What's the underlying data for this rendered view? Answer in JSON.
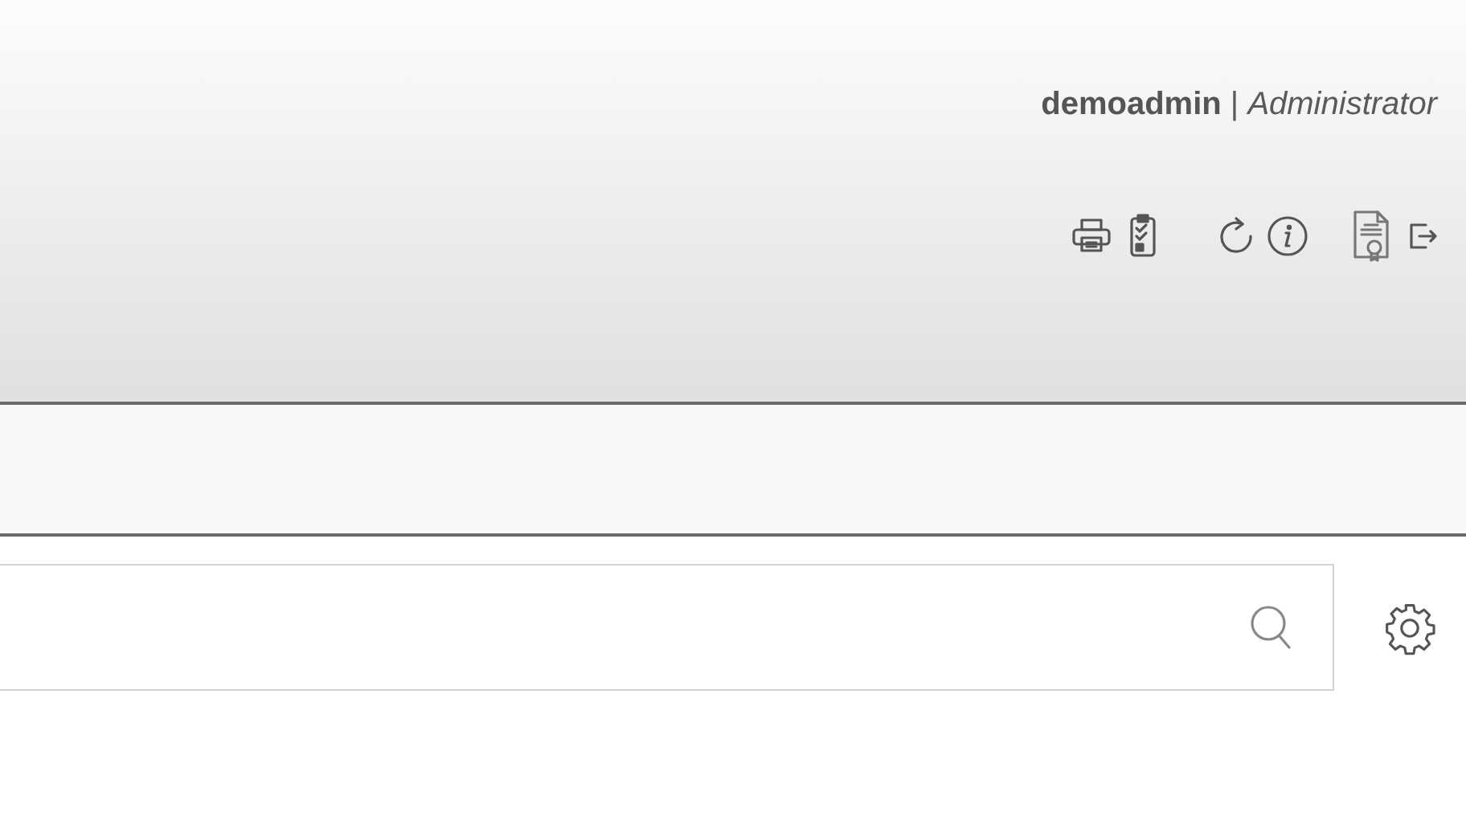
{
  "header": {
    "user_line": "**demoadmin** | *Administrator*"
  }
}
